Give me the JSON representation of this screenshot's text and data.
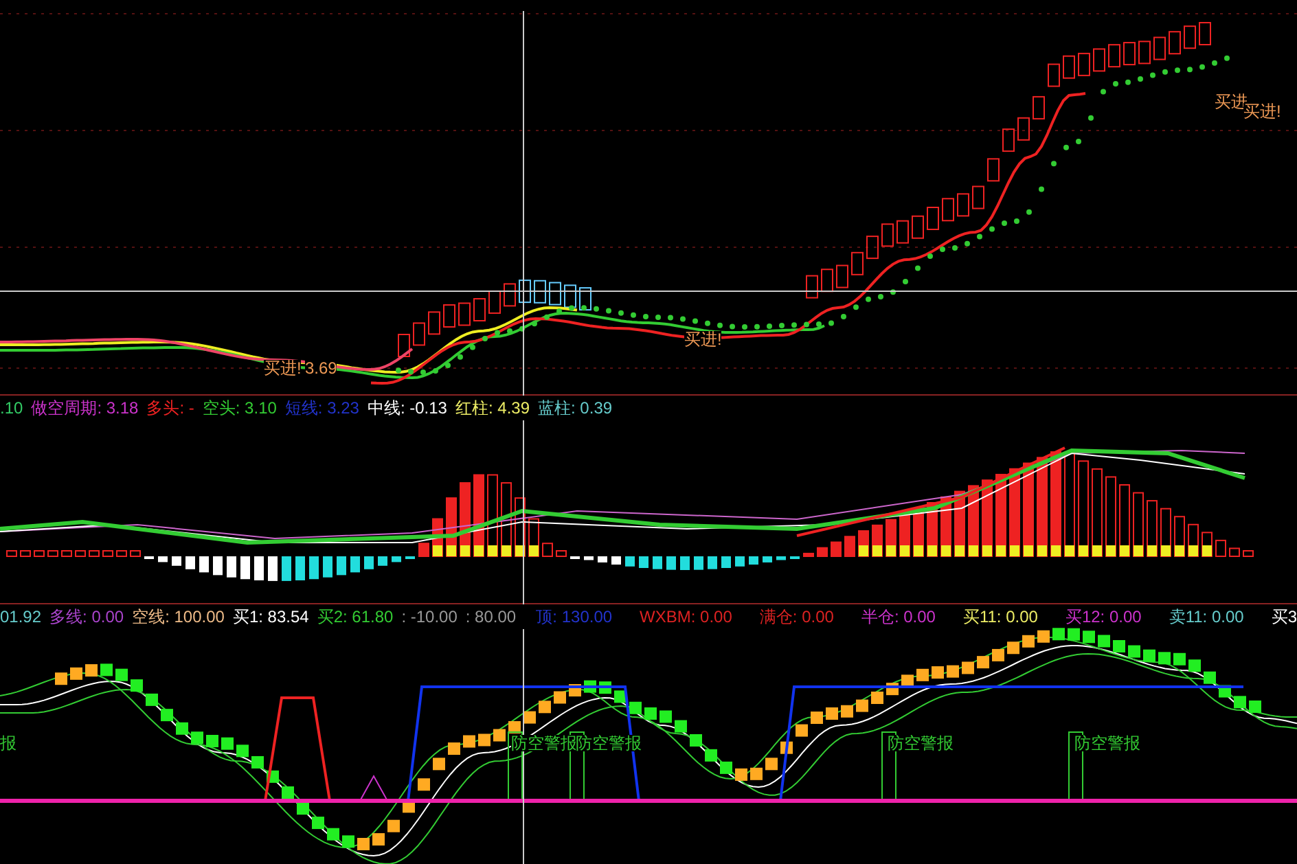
{
  "price_panel": {
    "labels": [
      "买进!",
      "3.69",
      "买进!",
      "买进",
      "买进!"
    ]
  },
  "indicator_panel": {
    "legend": [
      {
        "text": ".10",
        "color": "#33cc66"
      },
      {
        "text": "做空周期: 3.18",
        "color": "#cc33cc"
      },
      {
        "text": "多头: -",
        "color": "#ee2222"
      },
      {
        "text": "空头: 3.10",
        "color": "#33cc33"
      },
      {
        "text": "短线: 3.23",
        "color": "#2233cc"
      },
      {
        "text": "中线: -0.13",
        "color": "#ffffff"
      },
      {
        "text": "红柱: 4.39",
        "color": "#eeee66"
      },
      {
        "text": "蓝柱: 0.39",
        "color": "#66cccc"
      }
    ]
  },
  "oscillator_panel": {
    "legend": [
      {
        "text": "01.92",
        "color": "#66cccc"
      },
      {
        "text": "多线: 0.00",
        "color": "#aa44cc"
      },
      {
        "text": "空线: 100.00",
        "color": "#eebb88"
      },
      {
        "text": "买1: 83.54",
        "color": "#ffffff"
      },
      {
        "text": "买2: 61.80",
        "color": "#33cc33"
      },
      {
        "text": ": -10.00",
        "color": "#999999"
      },
      {
        "text": ": 80.00",
        "color": "#999999"
      }
    ],
    "legend_right": [
      {
        "text": "顶: 130.00",
        "color": "#2233cc"
      },
      {
        "text": "WXBM: 0.00",
        "color": "#dd2222"
      },
      {
        "text": "满仓: 0.00",
        "color": "#dd2222"
      },
      {
        "text": "半仓: 0.00",
        "color": "#cc33cc"
      },
      {
        "text": "买11: 0.00",
        "color": "#eeee66"
      },
      {
        "text": "买12: 0.00",
        "color": "#cc33cc"
      },
      {
        "text": "卖11: 0.00",
        "color": "#66cccc"
      },
      {
        "text": "买3",
        "color": "#ffffff"
      }
    ],
    "labels": [
      "报",
      "防空警报",
      "防空警报",
      "防空警报",
      "防空警报"
    ]
  }
}
